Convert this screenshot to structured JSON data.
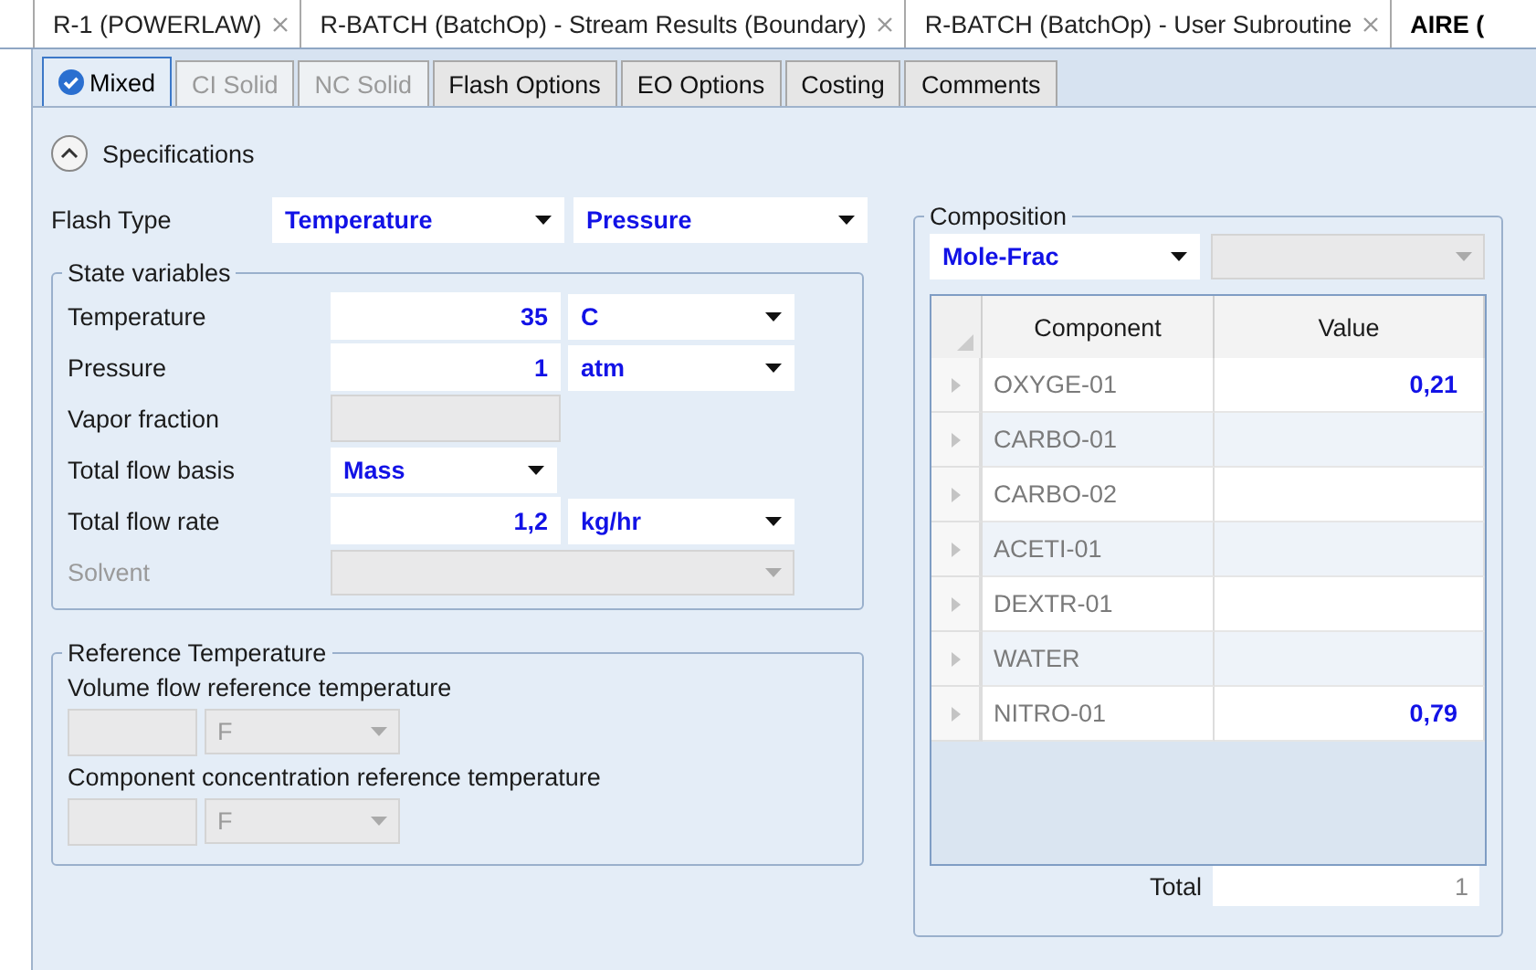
{
  "doc_tabs": [
    {
      "label": "R-1 (POWERLAW)",
      "selected": false
    },
    {
      "label": "R-BATCH (BatchOp) - Stream Results (Boundary)",
      "selected": false
    },
    {
      "label": "R-BATCH (BatchOp) - User Subroutine",
      "selected": false
    },
    {
      "label": "AIRE (",
      "selected": true
    }
  ],
  "sub_tabs": [
    {
      "label": "Mixed",
      "selected": true,
      "disabled": false,
      "complete": true
    },
    {
      "label": "CI Solid",
      "selected": false,
      "disabled": true,
      "complete": false
    },
    {
      "label": "NC Solid",
      "selected": false,
      "disabled": true,
      "complete": false
    },
    {
      "label": "Flash Options",
      "selected": false,
      "disabled": false,
      "complete": false
    },
    {
      "label": "EO Options",
      "selected": false,
      "disabled": false,
      "complete": false
    },
    {
      "label": "Costing",
      "selected": false,
      "disabled": false,
      "complete": false
    },
    {
      "label": "Comments",
      "selected": false,
      "disabled": false,
      "complete": false
    }
  ],
  "specifications": {
    "label": "Specifications",
    "expanded": true
  },
  "flash_type": {
    "label": "Flash Type",
    "first": "Temperature",
    "second": "Pressure"
  },
  "state_variables": {
    "title": "State variables",
    "rows": [
      {
        "label": "Temperature",
        "kind": "input_unit",
        "disabled": false,
        "value": "35",
        "unit": "C"
      },
      {
        "label": "Pressure",
        "kind": "input_unit",
        "disabled": false,
        "value": "1",
        "unit": "atm"
      },
      {
        "label": "Vapor fraction",
        "kind": "input",
        "disabled": true
      },
      {
        "label": "Total flow basis",
        "kind": "select",
        "disabled": false,
        "value": "Mass"
      },
      {
        "label": "Total flow rate",
        "kind": "input_unit",
        "disabled": false,
        "value": "1,2",
        "unit": "kg/hr"
      },
      {
        "label": "Solvent",
        "kind": "wide_select",
        "disabled": true
      }
    ]
  },
  "reference_temperature": {
    "title": "Reference Temperature",
    "items": [
      {
        "label": "Volume flow reference temperature",
        "unit": "F"
      },
      {
        "label": "Component concentration reference temperature",
        "unit": "F"
      }
    ]
  },
  "composition": {
    "title": "Composition",
    "basis": "Mole-Frac",
    "columns": [
      "Component",
      "Value"
    ],
    "rows": [
      {
        "component": "OXYGE-01",
        "value": "0,21"
      },
      {
        "component": "CARBO-01"
      },
      {
        "component": "CARBO-02"
      },
      {
        "component": "ACETI-01"
      },
      {
        "component": "DEXTR-01"
      },
      {
        "component": "WATER"
      },
      {
        "component": "NITRO-01",
        "value": "0,79"
      }
    ],
    "total_label": "Total",
    "total": "1"
  }
}
